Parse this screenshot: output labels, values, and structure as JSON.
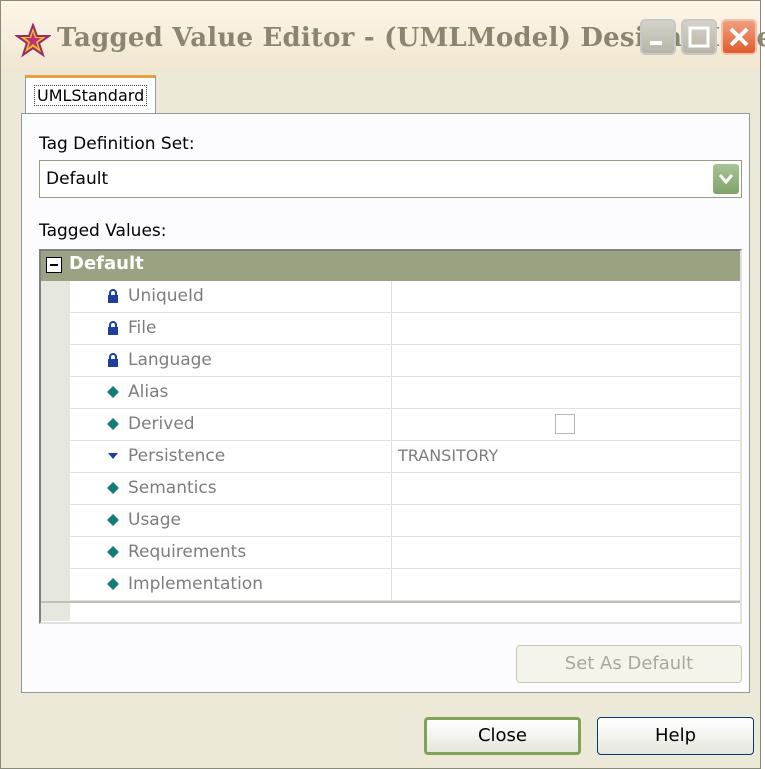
{
  "window": {
    "title": "Tagged Value Editor - (UMLModel) Design Model"
  },
  "tabs": [
    {
      "label": "UMLStandard"
    }
  ],
  "tag_definition": {
    "label": "Tag Definition Set:",
    "selected": "Default"
  },
  "tagged_values": {
    "label": "Tagged Values:",
    "group": "Default",
    "rows": [
      {
        "name": "UniqueId",
        "icon": "lock-icon",
        "value": ""
      },
      {
        "name": "File",
        "icon": "lock-icon",
        "value": ""
      },
      {
        "name": "Language",
        "icon": "lock-icon",
        "value": ""
      },
      {
        "name": "Alias",
        "icon": "diamond-icon",
        "value": ""
      },
      {
        "name": "Derived",
        "icon": "diamond-icon",
        "value": "",
        "checkbox": false
      },
      {
        "name": "Persistence",
        "icon": "dropdown-arrow-icon",
        "value": "TRANSITORY"
      },
      {
        "name": "Semantics",
        "icon": "diamond-icon",
        "value": ""
      },
      {
        "name": "Usage",
        "icon": "diamond-icon",
        "value": ""
      },
      {
        "name": "Requirements",
        "icon": "diamond-icon",
        "value": ""
      },
      {
        "name": "Implementation",
        "icon": "diamond-icon",
        "value": ""
      }
    ]
  },
  "buttons": {
    "set_default": "Set As Default",
    "close": "Close",
    "help": "Help"
  },
  "colors": {
    "group_header": "#9aa381",
    "icon_lock": "#1a3fa0",
    "icon_diamond": "#147a7a",
    "close_button": "#e05b2e"
  }
}
